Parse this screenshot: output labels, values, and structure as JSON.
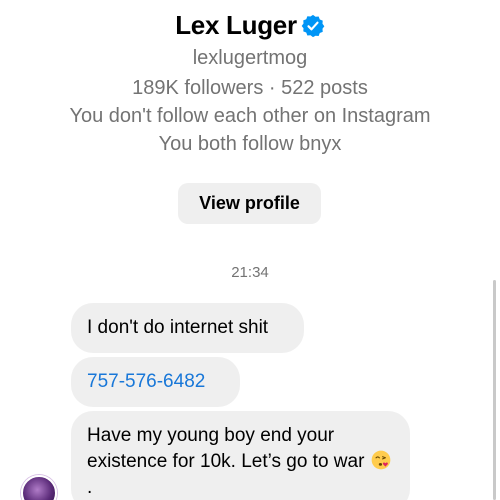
{
  "profile": {
    "name": "Lex Luger",
    "username": "lexlugertmog",
    "stats": "189K followers · 522 posts",
    "follow_status": "You don't follow each other on Instagram",
    "mutual": "You both follow bnyx",
    "view_profile_label": "View profile"
  },
  "chat": {
    "timestamp": "21:34",
    "messages": [
      {
        "text": "I don't do internet shit"
      },
      {
        "text": "757-576-6482"
      },
      {
        "text": "Have my young boy end your existence for 10k. Let’s go to war",
        "suffix": "."
      }
    ]
  },
  "colors": {
    "verified_blue": "#0095f6",
    "bubble_bg": "#efefef",
    "link_blue": "#1877d8",
    "secondary_text": "#737373"
  },
  "icons": {
    "verified": "verified-badge-icon",
    "emoji": "kissing-face-with-heart-emoji"
  }
}
